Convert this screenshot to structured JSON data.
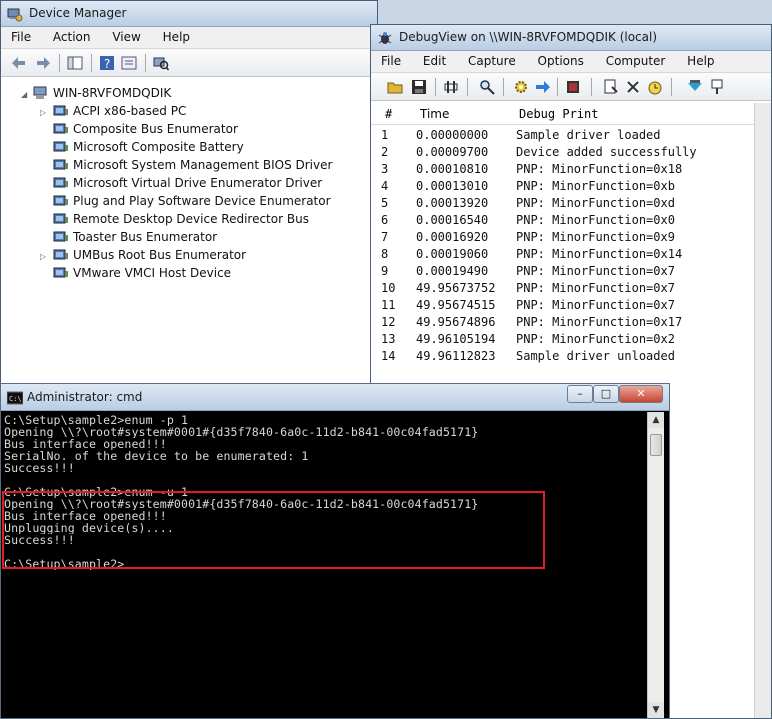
{
  "device_manager": {
    "title": "Device Manager",
    "menu": [
      "File",
      "Action",
      "View",
      "Help"
    ],
    "computer": "WIN-8RVFOMDQDIK",
    "devices": [
      {
        "label": "ACPI x86-based PC",
        "expandable": true
      },
      {
        "label": "Composite Bus Enumerator",
        "expandable": false
      },
      {
        "label": "Microsoft Composite Battery",
        "expandable": false
      },
      {
        "label": "Microsoft System Management BIOS Driver",
        "expandable": false
      },
      {
        "label": "Microsoft Virtual Drive Enumerator Driver",
        "expandable": false
      },
      {
        "label": "Plug and Play Software Device Enumerator",
        "expandable": false
      },
      {
        "label": "Remote Desktop Device Redirector Bus",
        "expandable": false
      },
      {
        "label": "Toaster Bus Enumerator",
        "expandable": false
      },
      {
        "label": "UMBus Root Bus Enumerator",
        "expandable": true
      },
      {
        "label": "VMware VMCI Host Device",
        "expandable": false
      }
    ]
  },
  "debugview": {
    "title": "DebugView on \\\\WIN-8RVFOMDQDIK (local)",
    "menu": [
      "File",
      "Edit",
      "Capture",
      "Options",
      "Computer",
      "Help"
    ],
    "columns": {
      "num": "#",
      "time": "Time",
      "print": "Debug Print"
    },
    "rows": [
      {
        "n": "1",
        "t": "0.00000000",
        "p": "Sample driver loaded"
      },
      {
        "n": "2",
        "t": "0.00009700",
        "p": "Device added successfully"
      },
      {
        "n": "3",
        "t": "0.00010810",
        "p": "PNP: MinorFunction=0x18"
      },
      {
        "n": "4",
        "t": "0.00013010",
        "p": "PNP: MinorFunction=0xb"
      },
      {
        "n": "5",
        "t": "0.00013920",
        "p": "PNP: MinorFunction=0xd"
      },
      {
        "n": "6",
        "t": "0.00016540",
        "p": "PNP: MinorFunction=0x0"
      },
      {
        "n": "7",
        "t": "0.00016920",
        "p": "PNP: MinorFunction=0x9"
      },
      {
        "n": "8",
        "t": "0.00019060",
        "p": "PNP: MinorFunction=0x14"
      },
      {
        "n": "9",
        "t": "0.00019490",
        "p": "PNP: MinorFunction=0x7"
      },
      {
        "n": "10",
        "t": "49.95673752",
        "p": "PNP: MinorFunction=0x7"
      },
      {
        "n": "11",
        "t": "49.95674515",
        "p": "PNP: MinorFunction=0x7"
      },
      {
        "n": "12",
        "t": "49.95674896",
        "p": "PNP: MinorFunction=0x17"
      },
      {
        "n": "13",
        "t": "49.96105194",
        "p": "PNP: MinorFunction=0x2"
      },
      {
        "n": "14",
        "t": "49.96112823",
        "p": "Sample driver unloaded"
      }
    ]
  },
  "cmd": {
    "title": "Administrator: cmd",
    "lines": [
      "C:\\Setup\\sample2>enum -p 1",
      "Opening \\\\?\\root#system#0001#{d35f7840-6a0c-11d2-b841-00c04fad5171}",
      "Bus interface opened!!!",
      "SerialNo. of the device to be enumerated: 1",
      "Success!!!",
      "",
      "C:\\Setup\\sample2>enum -u 1",
      "Opening \\\\?\\root#system#0001#{d35f7840-6a0c-11d2-b841-00c04fad5171}",
      "Bus interface opened!!!",
      "Unplugging device(s)....",
      "Success!!!",
      "",
      "C:\\Setup\\sample2>"
    ]
  },
  "window_controls": {
    "minimize": "–",
    "maximize": "□",
    "close": "✕"
  },
  "colors": {
    "highlight_border": "#e31b23",
    "console_bg": "#000000",
    "console_fg": "#d8d8d8"
  }
}
